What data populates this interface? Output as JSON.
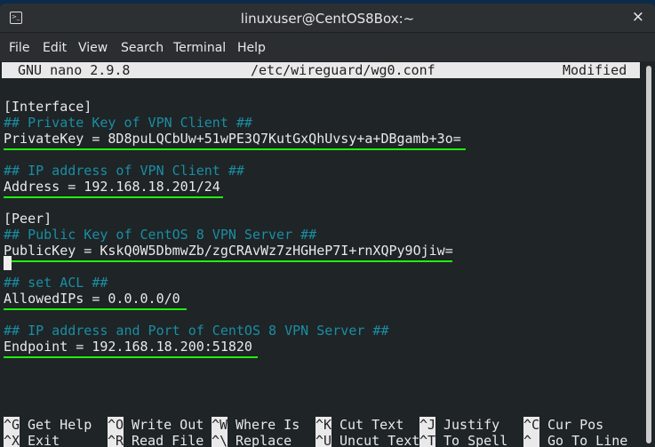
{
  "window": {
    "title": "linuxuser@CentOS8Box:~",
    "close_icon": "×"
  },
  "menu": [
    "File",
    "Edit",
    "View",
    "Search",
    "Terminal",
    "Help"
  ],
  "nano": {
    "version": "GNU nano 2.9.8",
    "file": "/etc/wireguard/wg0.conf",
    "state": "Modified"
  },
  "lines": [
    "[Interface]",
    "## Private Key of VPN Client ##",
    "PrivateKey = 8D8puLQCbUw+51wPE3Q7KutGxQhUvsy+a+DBgamb+3o=",
    "",
    "## IP address of VPN Client ##",
    "Address = 192.168.18.201/24",
    "",
    "[Peer]",
    "## Public Key of CentOS 8 VPN Server ##",
    "PublicKey = KskQ0W5DbmwZb/zgCRAvWz7zHGHeP7I+rnXQPy9Ojiw=",
    "",
    "## set ACL ##",
    "AllowedIPs = 0.0.0.0/0",
    "",
    "## IP address and Port of CentOS 8 VPN Server ##",
    "Endpoint = 192.168.18.200:51820"
  ],
  "shortcuts": [
    [
      {
        "k": "^G",
        "l": "Get Help"
      },
      {
        "k": "^O",
        "l": "Write Out"
      },
      {
        "k": "^W",
        "l": "Where Is"
      },
      {
        "k": "^K",
        "l": "Cut Text"
      },
      {
        "k": "^J",
        "l": "Justify"
      },
      {
        "k": "^C",
        "l": "Cur Pos"
      }
    ],
    [
      {
        "k": "^X",
        "l": "Exit"
      },
      {
        "k": "^R",
        "l": "Read File"
      },
      {
        "k": "^\\",
        "l": "Replace"
      },
      {
        "k": "^U",
        "l": "Uncut Text"
      },
      {
        "k": "^T",
        "l": "To Spell"
      },
      {
        "k": "^_",
        "l": "Go To Line"
      }
    ]
  ],
  "colors": {
    "comment": "#1a8ea3",
    "highlight": "#22ee11"
  }
}
